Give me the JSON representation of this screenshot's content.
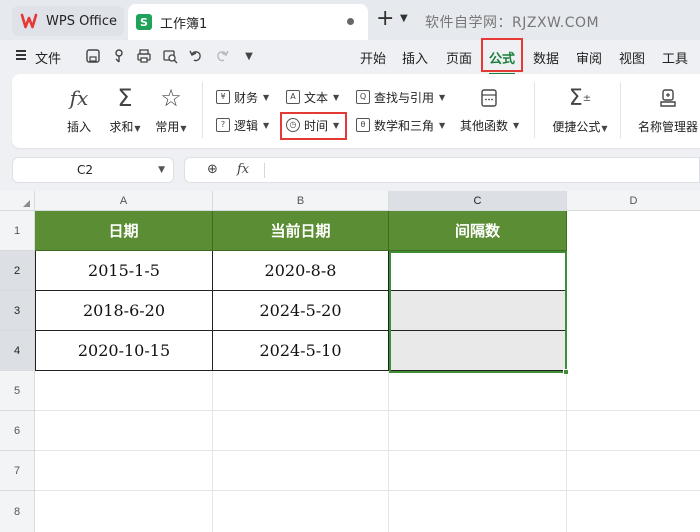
{
  "titlebar": {
    "home_tab": "WPS Office",
    "doc_tab": "工作簿1",
    "watermark": "软件自学网：RJZXW.COM"
  },
  "menubar": {
    "file": "文件",
    "tabs": [
      "开始",
      "插入",
      "页面",
      "公式",
      "数据",
      "审阅",
      "视图",
      "工具"
    ],
    "active_tab": "公式"
  },
  "ribbon": {
    "insert_func": "插入",
    "sum": "求和",
    "common": "常用",
    "finance": "财务",
    "text": "文本",
    "lookup": "查找与引用",
    "logic": "逻辑",
    "time": "时间",
    "math": "数学和三角",
    "other": "其他函数",
    "quick": "便捷公式",
    "name_mgr": "名称管理器"
  },
  "formula_bar": {
    "cell_ref": "C2",
    "fx_label": "fx",
    "formula": ""
  },
  "sheet": {
    "columns": [
      "A",
      "B",
      "C",
      "D"
    ],
    "rows": [
      "1",
      "2",
      "3",
      "4",
      "5",
      "6",
      "7",
      "8"
    ],
    "headers": [
      "日期",
      "当前日期",
      "间隔数"
    ],
    "data": [
      [
        "2015-1-5",
        "2020-8-8",
        ""
      ],
      [
        "2018-6-20",
        "2024-5-20",
        ""
      ],
      [
        "2020-10-15",
        "2024-5-10",
        ""
      ]
    ]
  },
  "colors": {
    "header_green": "#5b8e34",
    "active_green": "#1a7f3c",
    "highlight_red": "#e53935"
  }
}
